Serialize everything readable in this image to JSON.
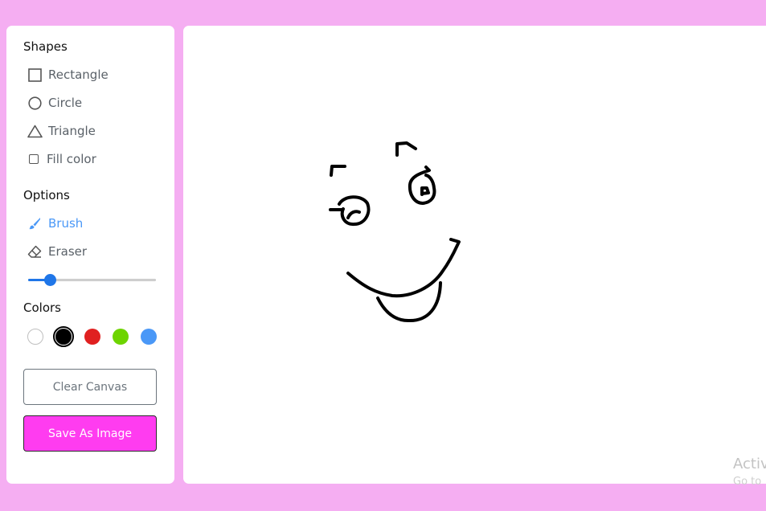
{
  "shapes": {
    "title": "Shapes",
    "items": [
      {
        "label": "Rectangle",
        "icon": "square-icon"
      },
      {
        "label": "Circle",
        "icon": "circle-icon"
      },
      {
        "label": "Triangle",
        "icon": "triangle-icon"
      }
    ],
    "fill_label": "Fill color",
    "fill_checked": false
  },
  "options": {
    "title": "Options",
    "brush_label": "Brush",
    "eraser_label": "Eraser",
    "active_tool": "brush",
    "brush_size_fraction": 0.17
  },
  "colors": {
    "title": "Colors",
    "swatches": [
      "#ffffff",
      "#000000",
      "#e02020",
      "#6dd400",
      "#4a98f7"
    ],
    "selected_index": 1
  },
  "buttons": {
    "clear_label": "Clear Canvas",
    "save_label": "Save As Image"
  },
  "watermark": {
    "title": "Activ",
    "subtitle": "Go to"
  },
  "theme": {
    "page_bg": "#f5aef2",
    "accent": "#4a98f7",
    "save_button": "#ff3cf0"
  }
}
